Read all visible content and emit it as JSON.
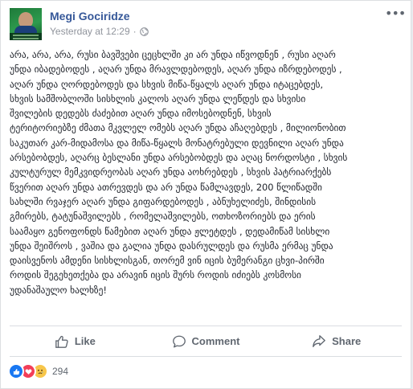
{
  "post": {
    "author": "Megi Gociridze",
    "timestamp": "Yesterday at 12:29",
    "separator": "·",
    "more_label": "•••",
    "lines": [
      "არა, არა, არა, რუსი ბავშვები ცეცხლში კი არ უნდა იწვოდნენ , რუსი აღარ",
      "უნდა იბადებოდეს , აღარ უნდა მრავლდებოდეს, აღარ უნდა იზრდებოდეს ,",
      "აღარ უნდა ღორდებოდეს და სხვის მიწა-წყალს აღარ უნდა იტაცებდეს,",
      "სხვის სამშობლოში სისხლის კალოს აღარ უნდა ლეწდეს და სხვისი",
      "შვილების დედებს ძაძებით აღარ უნდა იმოსებოდნენ, სხვის",
      "ტერიტორიებზე ძმათა მკვლელ ომებს აღარ უნდა აჩაღებდეს , მილიონობით",
      "საკუთარ კარ-მიდამოსა და მიწა-წყალს მონატრებული დევნილი აღარ უნდა",
      "არსებობდეს, აღარც ბესლანი უნდა არსებობდეს და აღაც ნორდოსტი , სხვის",
      "კულტურულ მემკვიდრეობას აღარ უნდა აოხრებდეს , სხვის პატრიარქებს",
      "წვერით აღარ უნდა ათრევდეს და არ უნდა წამლავდეს, 200 წლიწადში",
      "სახლში რვაჯერ აღარ უნდა გიფარდებოდეს , აბნუხელიძეს, შინდისის",
      "გმირებს, ტატუნაშვილებს , რომელაშვილებს, ოთხოზორიებს და ერის",
      "საამაყო გენოფონდს წამებით აღარ უნდა ჟლეტდეს , დედამიწამ სისხლი",
      "უნდა შეიშროს , ვაშია და გალია უნდა დასრულდეს და რუსმა ერმაც უნდა",
      "დაისვენოს ამდენი სისხლისგან, თორემ ვინ იცის ბუმერანგი ცხვი-პირში",
      "როდის შეგეხეთქება და არავინ იცის შურს როდის იძიებს კოსმოსი",
      "უდანაშაულო ხალხზე!"
    ]
  },
  "actions": {
    "like": "Like",
    "comment": "Comment",
    "share": "Share"
  },
  "reactions": {
    "count": "294",
    "types": [
      "like-icon",
      "love-icon",
      "sad-icon"
    ]
  },
  "colors": {
    "author": "#365899",
    "like": "#1877f2",
    "love": "#f33e58",
    "sad": "#f7c64a"
  }
}
